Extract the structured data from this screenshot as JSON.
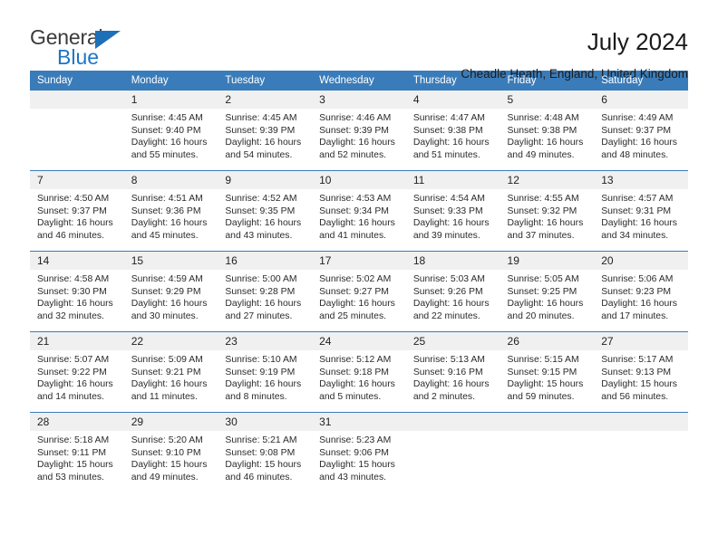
{
  "brand": {
    "name_top": "General",
    "name_bottom": "Blue",
    "triangle_color": "#1d6fb8",
    "blue_color": "#1d76c4"
  },
  "header": {
    "title": "July 2024",
    "subtitle": "Cheadle Heath, England, United Kingdom"
  },
  "theme": {
    "header_bg": "#3a7cba",
    "daynum_bg": "#f0f0f0",
    "row_divider": "#3a7cba"
  },
  "weekdays": [
    "Sunday",
    "Monday",
    "Tuesday",
    "Wednesday",
    "Thursday",
    "Friday",
    "Saturday"
  ],
  "weeks": [
    [
      {
        "empty": true
      },
      {
        "day": "1",
        "sunrise": "Sunrise: 4:45 AM",
        "sunset": "Sunset: 9:40 PM",
        "daylight": "Daylight: 16 hours and 55 minutes."
      },
      {
        "day": "2",
        "sunrise": "Sunrise: 4:45 AM",
        "sunset": "Sunset: 9:39 PM",
        "daylight": "Daylight: 16 hours and 54 minutes."
      },
      {
        "day": "3",
        "sunrise": "Sunrise: 4:46 AM",
        "sunset": "Sunset: 9:39 PM",
        "daylight": "Daylight: 16 hours and 52 minutes."
      },
      {
        "day": "4",
        "sunrise": "Sunrise: 4:47 AM",
        "sunset": "Sunset: 9:38 PM",
        "daylight": "Daylight: 16 hours and 51 minutes."
      },
      {
        "day": "5",
        "sunrise": "Sunrise: 4:48 AM",
        "sunset": "Sunset: 9:38 PM",
        "daylight": "Daylight: 16 hours and 49 minutes."
      },
      {
        "day": "6",
        "sunrise": "Sunrise: 4:49 AM",
        "sunset": "Sunset: 9:37 PM",
        "daylight": "Daylight: 16 hours and 48 minutes."
      }
    ],
    [
      {
        "day": "7",
        "sunrise": "Sunrise: 4:50 AM",
        "sunset": "Sunset: 9:37 PM",
        "daylight": "Daylight: 16 hours and 46 minutes."
      },
      {
        "day": "8",
        "sunrise": "Sunrise: 4:51 AM",
        "sunset": "Sunset: 9:36 PM",
        "daylight": "Daylight: 16 hours and 45 minutes."
      },
      {
        "day": "9",
        "sunrise": "Sunrise: 4:52 AM",
        "sunset": "Sunset: 9:35 PM",
        "daylight": "Daylight: 16 hours and 43 minutes."
      },
      {
        "day": "10",
        "sunrise": "Sunrise: 4:53 AM",
        "sunset": "Sunset: 9:34 PM",
        "daylight": "Daylight: 16 hours and 41 minutes."
      },
      {
        "day": "11",
        "sunrise": "Sunrise: 4:54 AM",
        "sunset": "Sunset: 9:33 PM",
        "daylight": "Daylight: 16 hours and 39 minutes."
      },
      {
        "day": "12",
        "sunrise": "Sunrise: 4:55 AM",
        "sunset": "Sunset: 9:32 PM",
        "daylight": "Daylight: 16 hours and 37 minutes."
      },
      {
        "day": "13",
        "sunrise": "Sunrise: 4:57 AM",
        "sunset": "Sunset: 9:31 PM",
        "daylight": "Daylight: 16 hours and 34 minutes."
      }
    ],
    [
      {
        "day": "14",
        "sunrise": "Sunrise: 4:58 AM",
        "sunset": "Sunset: 9:30 PM",
        "daylight": "Daylight: 16 hours and 32 minutes."
      },
      {
        "day": "15",
        "sunrise": "Sunrise: 4:59 AM",
        "sunset": "Sunset: 9:29 PM",
        "daylight": "Daylight: 16 hours and 30 minutes."
      },
      {
        "day": "16",
        "sunrise": "Sunrise: 5:00 AM",
        "sunset": "Sunset: 9:28 PM",
        "daylight": "Daylight: 16 hours and 27 minutes."
      },
      {
        "day": "17",
        "sunrise": "Sunrise: 5:02 AM",
        "sunset": "Sunset: 9:27 PM",
        "daylight": "Daylight: 16 hours and 25 minutes."
      },
      {
        "day": "18",
        "sunrise": "Sunrise: 5:03 AM",
        "sunset": "Sunset: 9:26 PM",
        "daylight": "Daylight: 16 hours and 22 minutes."
      },
      {
        "day": "19",
        "sunrise": "Sunrise: 5:05 AM",
        "sunset": "Sunset: 9:25 PM",
        "daylight": "Daylight: 16 hours and 20 minutes."
      },
      {
        "day": "20",
        "sunrise": "Sunrise: 5:06 AM",
        "sunset": "Sunset: 9:23 PM",
        "daylight": "Daylight: 16 hours and 17 minutes."
      }
    ],
    [
      {
        "day": "21",
        "sunrise": "Sunrise: 5:07 AM",
        "sunset": "Sunset: 9:22 PM",
        "daylight": "Daylight: 16 hours and 14 minutes."
      },
      {
        "day": "22",
        "sunrise": "Sunrise: 5:09 AM",
        "sunset": "Sunset: 9:21 PM",
        "daylight": "Daylight: 16 hours and 11 minutes."
      },
      {
        "day": "23",
        "sunrise": "Sunrise: 5:10 AM",
        "sunset": "Sunset: 9:19 PM",
        "daylight": "Daylight: 16 hours and 8 minutes."
      },
      {
        "day": "24",
        "sunrise": "Sunrise: 5:12 AM",
        "sunset": "Sunset: 9:18 PM",
        "daylight": "Daylight: 16 hours and 5 minutes."
      },
      {
        "day": "25",
        "sunrise": "Sunrise: 5:13 AM",
        "sunset": "Sunset: 9:16 PM",
        "daylight": "Daylight: 16 hours and 2 minutes."
      },
      {
        "day": "26",
        "sunrise": "Sunrise: 5:15 AM",
        "sunset": "Sunset: 9:15 PM",
        "daylight": "Daylight: 15 hours and 59 minutes."
      },
      {
        "day": "27",
        "sunrise": "Sunrise: 5:17 AM",
        "sunset": "Sunset: 9:13 PM",
        "daylight": "Daylight: 15 hours and 56 minutes."
      }
    ],
    [
      {
        "day": "28",
        "sunrise": "Sunrise: 5:18 AM",
        "sunset": "Sunset: 9:11 PM",
        "daylight": "Daylight: 15 hours and 53 minutes."
      },
      {
        "day": "29",
        "sunrise": "Sunrise: 5:20 AM",
        "sunset": "Sunset: 9:10 PM",
        "daylight": "Daylight: 15 hours and 49 minutes."
      },
      {
        "day": "30",
        "sunrise": "Sunrise: 5:21 AM",
        "sunset": "Sunset: 9:08 PM",
        "daylight": "Daylight: 15 hours and 46 minutes."
      },
      {
        "day": "31",
        "sunrise": "Sunrise: 5:23 AM",
        "sunset": "Sunset: 9:06 PM",
        "daylight": "Daylight: 15 hours and 43 minutes."
      },
      {
        "empty": true
      },
      {
        "empty": true
      },
      {
        "empty": true
      }
    ]
  ]
}
